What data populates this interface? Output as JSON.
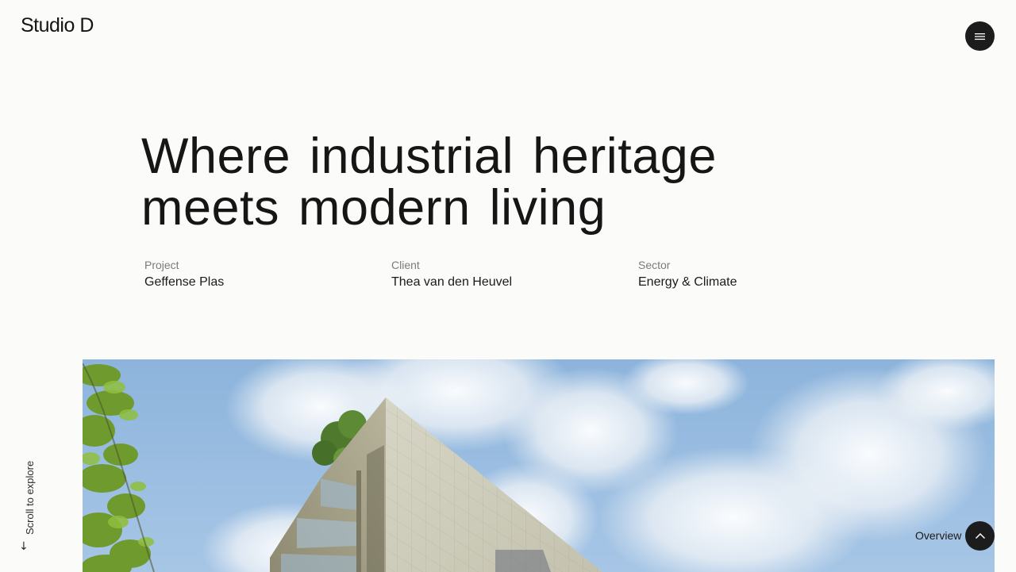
{
  "brand": {
    "logo_text": "Studio D"
  },
  "header": {
    "menu_icon": "hamburger-menu-icon"
  },
  "hero": {
    "headline_line1": "Where industrial heritage",
    "headline_line2": "meets modern living",
    "image_alt": "Modern building facade with pale stone cladding and balconies against a blue sky with clouds, tree foliage on the left"
  },
  "meta": {
    "project_label": "Project",
    "project_value": "Geffense Plas",
    "client_label": "Client",
    "client_value": "Thea van den Heuvel",
    "sector_label": "Sector",
    "sector_value": "Energy & Climate"
  },
  "scroll": {
    "text": "Scroll to explore",
    "arrow": "↓"
  },
  "footer_nav": {
    "overview_label": "Overview",
    "top_icon": "chevron-up-icon"
  },
  "colors": {
    "background": "#fbfbf9",
    "text": "#161616",
    "muted": "#7b7b7b",
    "button": "#1c1c1c"
  }
}
